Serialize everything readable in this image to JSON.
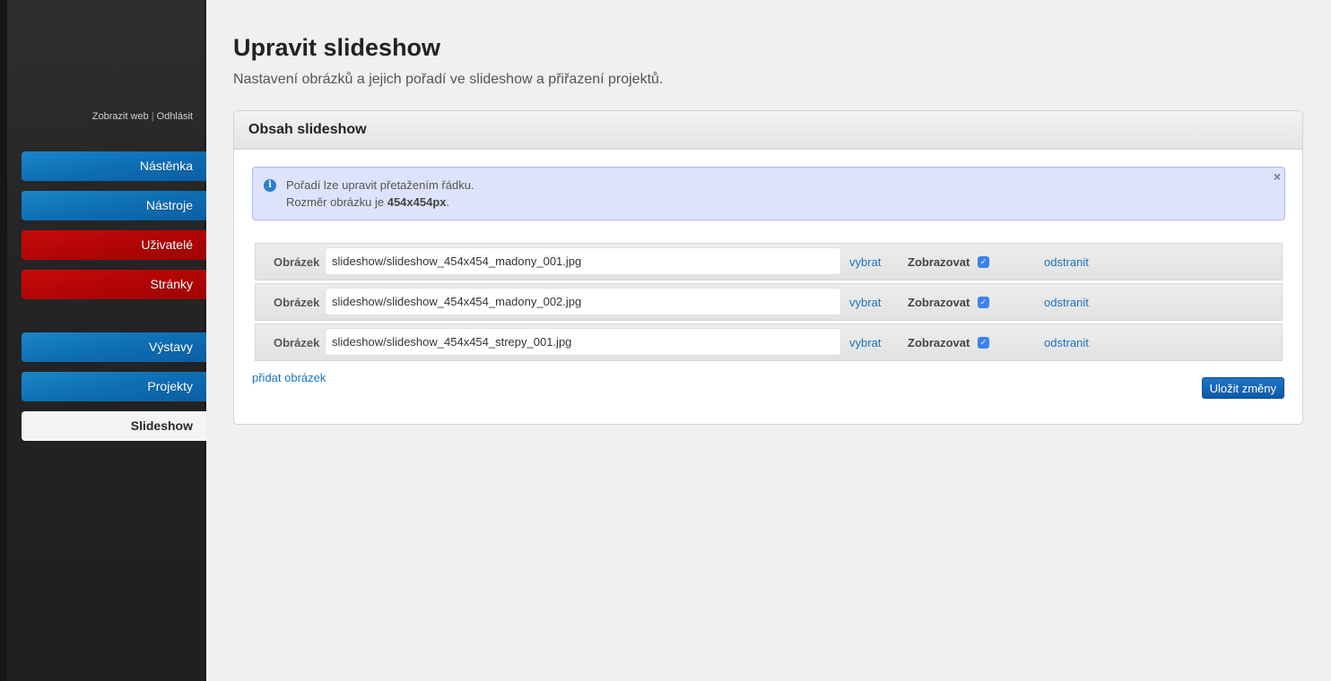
{
  "sidebar": {
    "top_links": {
      "view_site": "Zobrazit web",
      "separator": "|",
      "logout": "Odhlásit"
    },
    "items": [
      {
        "label": "Nástěnka",
        "color": "blue"
      },
      {
        "label": "Nástroje",
        "color": "blue"
      },
      {
        "label": "Uživatelé",
        "color": "red"
      },
      {
        "label": "Stránky",
        "color": "red"
      },
      {
        "label": "Výstavy",
        "color": "blue"
      },
      {
        "label": "Projekty",
        "color": "blue"
      },
      {
        "label": "Slideshow",
        "color": "white",
        "active": true
      }
    ]
  },
  "page": {
    "title": "Upravit slideshow",
    "subtitle": "Nastavení obrázků a jejich pořadí ve slideshow a přiřazení projektů."
  },
  "panel": {
    "title": "Obsah slideshow",
    "alert": {
      "line1": "Pořadí lze upravit přetažením řádku.",
      "line2_prefix": "Rozměr obrázku je ",
      "line2_bold": "454x454px",
      "line2_suffix": ".",
      "close": "×"
    },
    "rows": [
      {
        "label": "Obrázek",
        "value": "slideshow/slideshow_454x454_madony_001.jpg",
        "choose": "vybrat",
        "show_label": "Zobrazovat",
        "show_checked": true,
        "remove": "odstranit"
      },
      {
        "label": "Obrázek",
        "value": "slideshow/slideshow_454x454_madony_002.jpg",
        "choose": "vybrat",
        "show_label": "Zobrazovat",
        "show_checked": true,
        "remove": "odstranit"
      },
      {
        "label": "Obrázek",
        "value": "slideshow/slideshow_454x454_strepy_001.jpg",
        "choose": "vybrat",
        "show_label": "Zobrazovat",
        "show_checked": true,
        "remove": "odstranit"
      }
    ],
    "add_image": "přidat obrázek",
    "save_label": "Uložit změny"
  },
  "colors": {
    "nav_blue": "#0e6fb4",
    "nav_red": "#b30505",
    "link": "#1a73c2",
    "alert_bg": "#dde3fb",
    "checkbox": "#3b82f0"
  }
}
